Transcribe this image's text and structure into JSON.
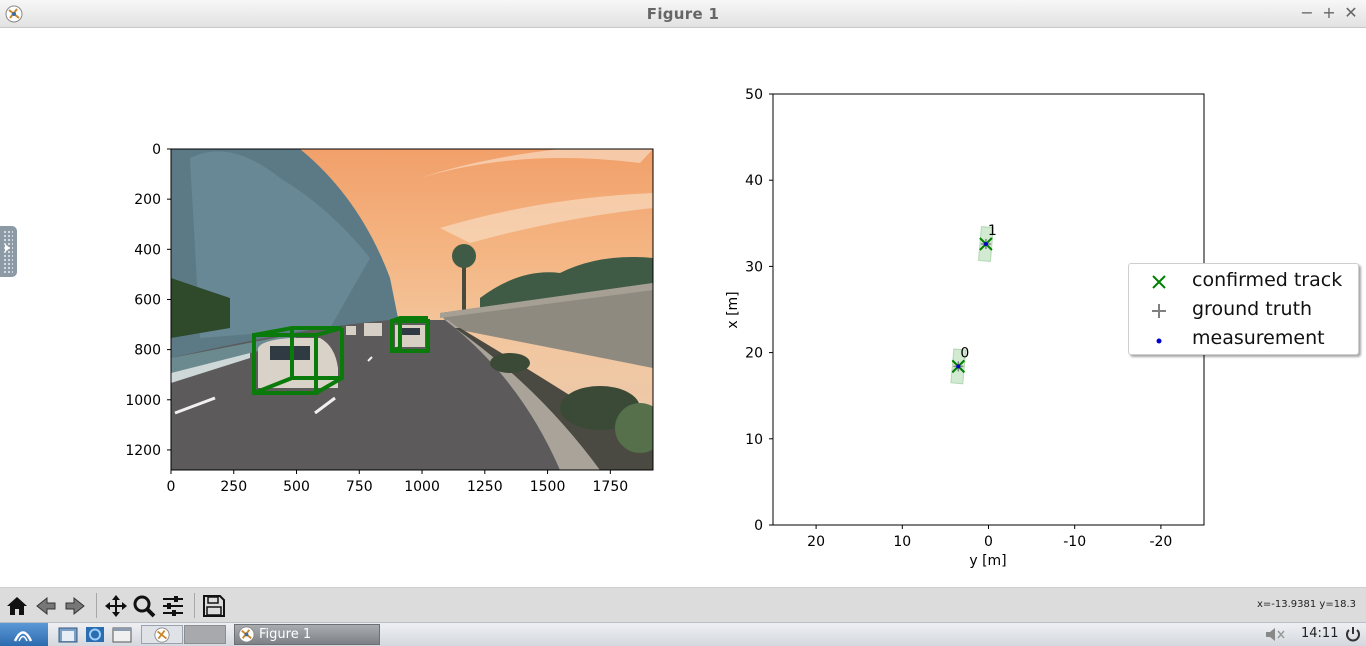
{
  "window": {
    "title": "Figure 1",
    "minimize": "−",
    "maximize": "+",
    "close": "✕"
  },
  "left_plot": {
    "chart_data": {
      "type": "image",
      "x_ticks": [
        "0",
        "250",
        "500",
        "750",
        "1000",
        "1250",
        "1500",
        "1750"
      ],
      "y_ticks": [
        "0",
        "200",
        "400",
        "600",
        "800",
        "1000",
        "1200"
      ],
      "xlim": [
        0,
        1920
      ],
      "ylim": [
        1280,
        0
      ],
      "detections": [
        {
          "x0": 330,
          "y0": 720,
          "x1": 680,
          "y1": 970
        },
        {
          "x0": 880,
          "y0": 680,
          "x1": 1030,
          "y1": 810
        }
      ],
      "box_color": "#0a7a0a"
    }
  },
  "right_plot": {
    "chart_data": {
      "type": "scatter",
      "xlabel": "y [m]",
      "ylabel": "x [m]",
      "xlim": [
        25,
        -25
      ],
      "ylim": [
        0,
        50
      ],
      "x_ticks": [
        "20",
        "10",
        "0",
        "-10",
        "-20"
      ],
      "y_ticks": [
        "0",
        "10",
        "20",
        "30",
        "40",
        "50"
      ],
      "tracks": [
        {
          "id": "0",
          "y": 3.5,
          "x": 18.4
        },
        {
          "id": "1",
          "y": 0.3,
          "x": 32.6
        }
      ],
      "legend": {
        "items": [
          {
            "label": "confirmed track",
            "marker": "x",
            "color": "#008000"
          },
          {
            "label": "ground truth",
            "marker": "+",
            "color": "#808080"
          },
          {
            "label": "measurement",
            "marker": "dot",
            "color": "#0000cc"
          }
        ],
        "placement": "center-right"
      }
    }
  },
  "toolbar": {
    "buttons": [
      "home-icon",
      "back-icon",
      "forward-icon",
      "pan-icon",
      "zoom-icon",
      "configure-icon",
      "save-icon"
    ],
    "coords": "x=-13.9381 y=18.3"
  },
  "taskbar": {
    "task_label": "Figure 1",
    "clock": "14:11"
  }
}
